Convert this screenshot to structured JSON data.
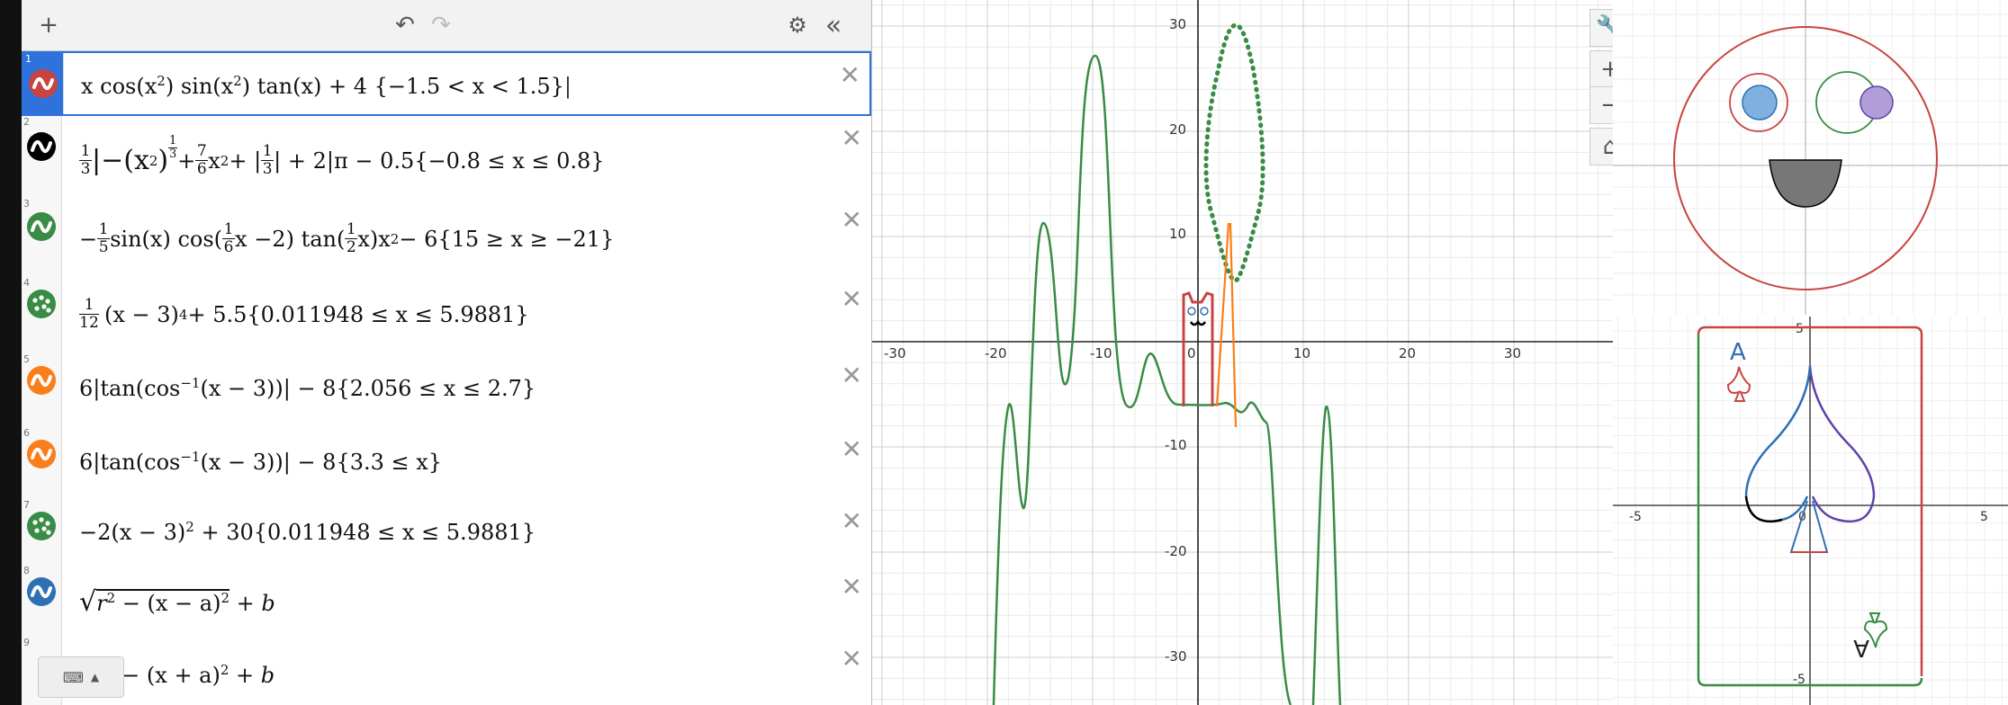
{
  "toolbar": {
    "add_icon": "plus-icon",
    "undo_icon": "undo-icon",
    "redo_icon": "redo-icon",
    "settings_icon": "gear-icon",
    "collapse_icon": "double-chevron-left-icon"
  },
  "expressions": [
    {
      "num": "1",
      "color": "#c74440",
      "icon": "wave-icon",
      "active": true
    },
    {
      "num": "2",
      "color": "#000000",
      "icon": "wave-icon"
    },
    {
      "num": "3",
      "color": "#388c46",
      "icon": "wave-icon"
    },
    {
      "num": "4",
      "color": "#388c46",
      "icon": "dots-icon"
    },
    {
      "num": "5",
      "color": "#fa7e19",
      "icon": "wave-icon"
    },
    {
      "num": "6",
      "color": "#fa7e19",
      "icon": "wave-icon"
    },
    {
      "num": "7",
      "color": "#388c46",
      "icon": "dots-icon"
    },
    {
      "num": "8",
      "color": "#2d70b3",
      "icon": "wave-icon"
    },
    {
      "num": "9",
      "color": "#388c46",
      "icon": "wave-icon"
    }
  ],
  "expr_text": {
    "e1_a": "x cos(x",
    "e1_b": "2",
    "e1_c": ") sin(x",
    "e1_d": "2",
    "e1_e": ") tan(x) + 4 {−1.5 < x < 1.5}",
    "e2_a": "1",
    "e2_b": "3",
    "e2_c": "|−(x",
    "e2_d": "2",
    "e2_e": ")",
    "e2_f": "1",
    "e2_g": "3",
    "e2_h": " + ",
    "e2_i": "7",
    "e2_j": "6",
    "e2_k": "x",
    "e2_l": "2",
    "e2_m": " + |",
    "e2_n": "1",
    "e2_o": "3",
    "e2_p": "| + 2|π − 0.5{−0.8 ≤ x ≤ 0.8}",
    "e3_a": "−",
    "e3_b": "1",
    "e3_c": "5",
    "e3_d": " sin(x) cos(",
    "e3_e": "1",
    "e3_f": "6",
    "e3_g": "x −2) tan(",
    "e3_h": "1",
    "e3_i": "2",
    "e3_j": "x)x",
    "e3_k": "2",
    "e3_l": " − 6{15 ≥ x ≥ −21}",
    "e4_a": "1",
    "e4_b": "12",
    "e4_c": "(x − 3)",
    "e4_d": "4",
    "e4_e": " + 5.5{0.011948 ≤ x ≤ 5.9881}",
    "e5_a": "6|tan(cos",
    "e5_b": "−1",
    "e5_c": "(x − 3))| − 8{2.056 ≤ x ≤ 2.7}",
    "e6_a": "6|tan(cos",
    "e6_b": "−1",
    "e6_c": "(x − 3))| − 8{3.3 ≤ x}",
    "e7_a": "−2(x − 3)",
    "e7_b": "2",
    "e7_c": " + 30{0.011948 ≤ x ≤ 5.9881}",
    "e8_a": "√",
    "e8_b": "r",
    "e8_c": "2",
    "e8_d": " − (x − a)",
    "e8_e": "2",
    "e8_f": " + b",
    "e9_a": "2",
    "e9_b": " − (x + a)",
    "e9_c": "2",
    "e9_d": " + b"
  },
  "graph": {
    "x_ticks": [
      "-30",
      "-20",
      "-10",
      "0",
      "10",
      "20",
      "30"
    ],
    "y_ticks": [
      "30",
      "20",
      "10",
      "-10",
      "-20",
      "-30"
    ],
    "buttons": {
      "wrench": "wrench-icon",
      "zoom_in": "+",
      "zoom_out": "−",
      "home": "home-icon"
    }
  },
  "inset_bottom": {
    "x_ticks": [
      "-5",
      "0",
      "5"
    ],
    "y_top": "5",
    "y_bottom": "-5",
    "card_letter": "A"
  },
  "colors": {
    "red": "#c74440",
    "green": "#388c46",
    "orange": "#fa7e19",
    "blue": "#2d70b3",
    "purple": "#6042a6",
    "black": "#000000"
  }
}
